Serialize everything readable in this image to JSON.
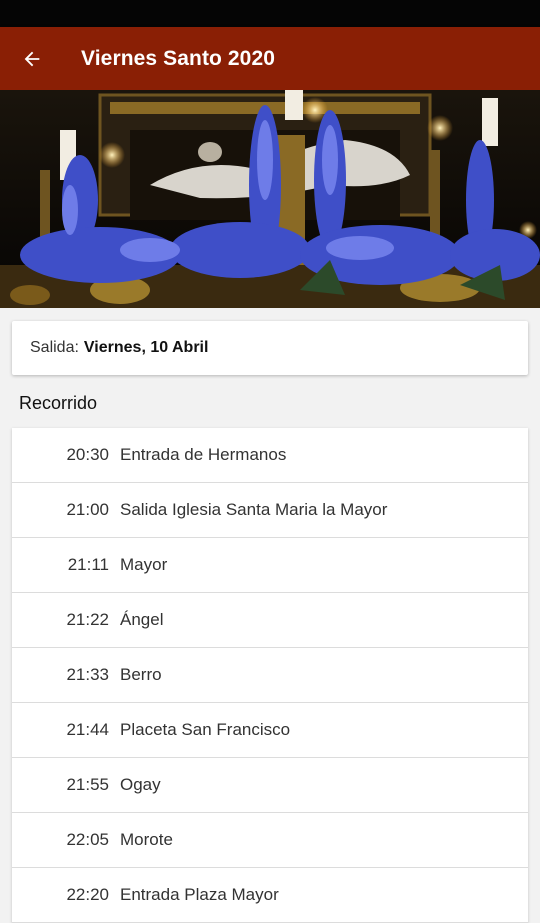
{
  "app_bar": {
    "title": "Viernes Santo 2020",
    "back_icon": "arrow-left-icon",
    "background": "#8a1f05"
  },
  "hero_image": {
    "description_icon": "procession-float-image"
  },
  "salida": {
    "label": "Salida:",
    "value": "Viernes, 10 Abril"
  },
  "recorrido": {
    "title": "Recorrido",
    "items": [
      {
        "time": "20:30",
        "place": "Entrada de Hermanos"
      },
      {
        "time": "21:00",
        "place": "Salida Iglesia Santa Maria la Mayor"
      },
      {
        "time": "21:11",
        "place": "Mayor"
      },
      {
        "time": "21:22",
        "place": "Ángel"
      },
      {
        "time": "21:33",
        "place": "Berro"
      },
      {
        "time": "21:44",
        "place": "Placeta San Francisco"
      },
      {
        "time": "21:55",
        "place": "Ogay"
      },
      {
        "time": "22:05",
        "place": "Morote"
      },
      {
        "time": "22:20",
        "place": "Entrada Plaza Mayor"
      }
    ]
  }
}
